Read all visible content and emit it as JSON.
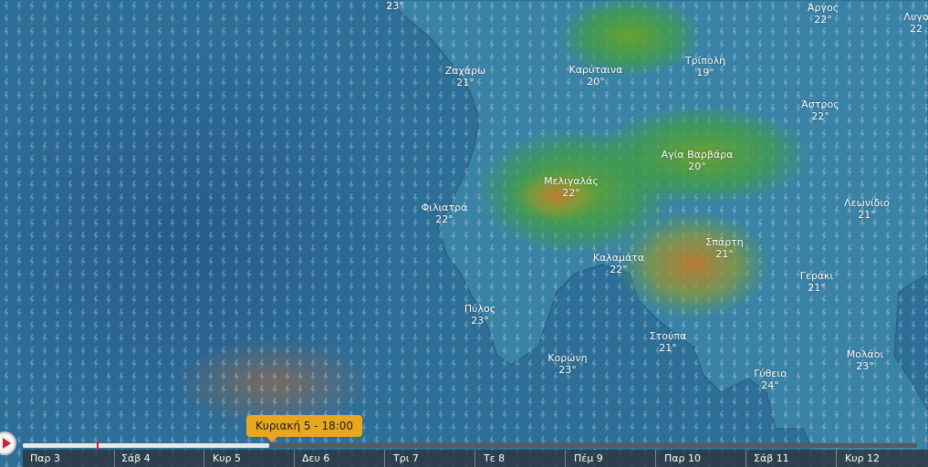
{
  "map": {
    "cities": [
      {
        "name": "Άργος",
        "temp": "22°"
      },
      {
        "name": "Λυγο",
        "temp": "22"
      },
      {
        "name": "Ζαχάρω",
        "temp": "21°"
      },
      {
        "name": "Καρύταινα",
        "temp": "20°"
      },
      {
        "name": "Τρίπολη",
        "temp": "19°"
      },
      {
        "name": "Άστρος",
        "temp": "22°"
      },
      {
        "name": "Αγία Βαρβάρα",
        "temp": "20°"
      },
      {
        "name": "Μελιγαλάς",
        "temp": "22°"
      },
      {
        "name": "Φιλιατρά",
        "temp": "22°"
      },
      {
        "name": "Λεωνίδιο",
        "temp": "21°"
      },
      {
        "name": "Σπάρτη",
        "temp": "21°"
      },
      {
        "name": "Καλαμάτα",
        "temp": "22°"
      },
      {
        "name": "Γεράκι",
        "temp": "21°"
      },
      {
        "name": "Πύλος",
        "temp": "23°"
      },
      {
        "name": "Στούπα",
        "temp": "21°"
      },
      {
        "name": "Κορώνη",
        "temp": "23°"
      },
      {
        "name": "Μολάοι",
        "temp": "23°"
      },
      {
        "name": "Γύθειο",
        "temp": "24°"
      },
      {
        "name": "",
        "temp": "23°"
      }
    ],
    "colors": {
      "sea": "#2e6f98",
      "land": "#3d86a8",
      "rain_green": "#3f9e45",
      "rain_orange": "#c27a2e",
      "accent": "#e9a71f"
    },
    "icons": [
      "lightning-icon",
      "play-icon"
    ]
  },
  "timeline": {
    "current_label": "Κυριακή 5 - 18:00",
    "progress": 0.276,
    "days": [
      "Παρ 3",
      "Σάβ 4",
      "Κυρ 5",
      "Δευ 6",
      "Τρι 7",
      "Τε 8",
      "Πέμ 9",
      "Παρ 10",
      "Σάβ 11",
      "Κυρ 12"
    ]
  }
}
